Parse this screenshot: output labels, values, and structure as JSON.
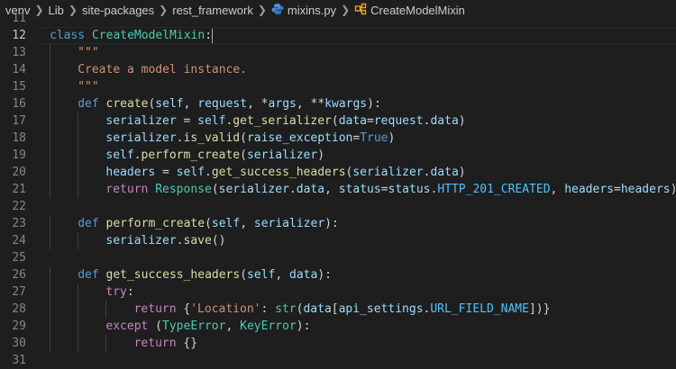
{
  "breadcrumb": {
    "items": [
      "venv",
      "Lib",
      "site-packages",
      "rest_framework",
      "mixins.py",
      "CreateModelMixin"
    ]
  },
  "editor": {
    "colors": {
      "background": "#1e1e1e",
      "keyword": "#569cd6",
      "class": "#4ec9b0",
      "function": "#dcdcaa",
      "string": "#ce9178"
    },
    "lines": [
      {
        "n": "11",
        "active": false,
        "indent": 0,
        "tokens": []
      },
      {
        "n": "12",
        "active": true,
        "indent": 0,
        "tokens": [
          [
            "kw",
            "class"
          ],
          [
            "plain",
            " "
          ],
          [
            "cls",
            "CreateModelMixin"
          ],
          [
            "plain",
            ":"
          ]
        ],
        "cursor": true
      },
      {
        "n": "13",
        "active": false,
        "indent": 1,
        "tokens": [
          [
            "str",
            "\"\"\""
          ]
        ]
      },
      {
        "n": "14",
        "active": false,
        "indent": 1,
        "tokens": [
          [
            "str",
            "Create a model instance."
          ]
        ]
      },
      {
        "n": "15",
        "active": false,
        "indent": 1,
        "tokens": [
          [
            "str",
            "\"\"\""
          ]
        ]
      },
      {
        "n": "16",
        "active": false,
        "indent": 1,
        "tokens": [
          [
            "kw",
            "def"
          ],
          [
            "plain",
            " "
          ],
          [
            "fn",
            "create"
          ],
          [
            "plain",
            "("
          ],
          [
            "self",
            "self"
          ],
          [
            "plain",
            ", "
          ],
          [
            "var",
            "request"
          ],
          [
            "plain",
            ", *"
          ],
          [
            "var",
            "args"
          ],
          [
            "plain",
            ", **"
          ],
          [
            "var",
            "kwargs"
          ],
          [
            "plain",
            "):"
          ]
        ]
      },
      {
        "n": "17",
        "active": false,
        "indent": 2,
        "tokens": [
          [
            "var",
            "serializer"
          ],
          [
            "plain",
            " = "
          ],
          [
            "self",
            "self"
          ],
          [
            "plain",
            "."
          ],
          [
            "fn",
            "get_serializer"
          ],
          [
            "plain",
            "("
          ],
          [
            "var",
            "data"
          ],
          [
            "plain",
            "="
          ],
          [
            "var",
            "request"
          ],
          [
            "plain",
            "."
          ],
          [
            "var",
            "data"
          ],
          [
            "plain",
            ")"
          ]
        ]
      },
      {
        "n": "18",
        "active": false,
        "indent": 2,
        "tokens": [
          [
            "var",
            "serializer"
          ],
          [
            "plain",
            "."
          ],
          [
            "fn",
            "is_valid"
          ],
          [
            "plain",
            "("
          ],
          [
            "var",
            "raise_exception"
          ],
          [
            "plain",
            "="
          ],
          [
            "kw",
            "True"
          ],
          [
            "plain",
            ")"
          ]
        ]
      },
      {
        "n": "19",
        "active": false,
        "indent": 2,
        "tokens": [
          [
            "self",
            "self"
          ],
          [
            "plain",
            "."
          ],
          [
            "fn",
            "perform_create"
          ],
          [
            "plain",
            "("
          ],
          [
            "var",
            "serializer"
          ],
          [
            "plain",
            ")"
          ]
        ]
      },
      {
        "n": "20",
        "active": false,
        "indent": 2,
        "tokens": [
          [
            "var",
            "headers"
          ],
          [
            "plain",
            " = "
          ],
          [
            "self",
            "self"
          ],
          [
            "plain",
            "."
          ],
          [
            "fn",
            "get_success_headers"
          ],
          [
            "plain",
            "("
          ],
          [
            "var",
            "serializer"
          ],
          [
            "plain",
            "."
          ],
          [
            "var",
            "data"
          ],
          [
            "plain",
            ")"
          ]
        ]
      },
      {
        "n": "21",
        "active": false,
        "indent": 2,
        "tokens": [
          [
            "flow",
            "return"
          ],
          [
            "plain",
            " "
          ],
          [
            "cls",
            "Response"
          ],
          [
            "plain",
            "("
          ],
          [
            "var",
            "serializer"
          ],
          [
            "plain",
            "."
          ],
          [
            "var",
            "data"
          ],
          [
            "plain",
            ", "
          ],
          [
            "var",
            "status"
          ],
          [
            "plain",
            "="
          ],
          [
            "var",
            "status"
          ],
          [
            "plain",
            "."
          ],
          [
            "const",
            "HTTP_201_CREATED"
          ],
          [
            "plain",
            ", "
          ],
          [
            "var",
            "headers"
          ],
          [
            "plain",
            "="
          ],
          [
            "var",
            "headers"
          ],
          [
            "plain",
            ")"
          ]
        ]
      },
      {
        "n": "22",
        "active": false,
        "indent": 0,
        "tokens": []
      },
      {
        "n": "23",
        "active": false,
        "indent": 1,
        "tokens": [
          [
            "kw",
            "def"
          ],
          [
            "plain",
            " "
          ],
          [
            "fn",
            "perform_create"
          ],
          [
            "plain",
            "("
          ],
          [
            "self",
            "self"
          ],
          [
            "plain",
            ", "
          ],
          [
            "var",
            "serializer"
          ],
          [
            "plain",
            "):"
          ]
        ]
      },
      {
        "n": "24",
        "active": false,
        "indent": 2,
        "tokens": [
          [
            "var",
            "serializer"
          ],
          [
            "plain",
            "."
          ],
          [
            "fn",
            "save"
          ],
          [
            "plain",
            "()"
          ]
        ]
      },
      {
        "n": "25",
        "active": false,
        "indent": 0,
        "tokens": []
      },
      {
        "n": "26",
        "active": false,
        "indent": 1,
        "tokens": [
          [
            "kw",
            "def"
          ],
          [
            "plain",
            " "
          ],
          [
            "fn",
            "get_success_headers"
          ],
          [
            "plain",
            "("
          ],
          [
            "self",
            "self"
          ],
          [
            "plain",
            ", "
          ],
          [
            "var",
            "data"
          ],
          [
            "plain",
            "):"
          ]
        ]
      },
      {
        "n": "27",
        "active": false,
        "indent": 2,
        "tokens": [
          [
            "flow",
            "try"
          ],
          [
            "plain",
            ":"
          ]
        ]
      },
      {
        "n": "28",
        "active": false,
        "indent": 3,
        "tokens": [
          [
            "flow",
            "return"
          ],
          [
            "plain",
            " {"
          ],
          [
            "str",
            "'Location'"
          ],
          [
            "plain",
            ": "
          ],
          [
            "cls",
            "str"
          ],
          [
            "plain",
            "("
          ],
          [
            "var",
            "data"
          ],
          [
            "plain",
            "["
          ],
          [
            "var",
            "api_settings"
          ],
          [
            "plain",
            "."
          ],
          [
            "const",
            "URL_FIELD_NAME"
          ],
          [
            "plain",
            "])}"
          ]
        ]
      },
      {
        "n": "29",
        "active": false,
        "indent": 2,
        "tokens": [
          [
            "flow",
            "except"
          ],
          [
            "plain",
            " ("
          ],
          [
            "cls",
            "TypeError"
          ],
          [
            "plain",
            ", "
          ],
          [
            "cls",
            "KeyError"
          ],
          [
            "plain",
            "):"
          ]
        ]
      },
      {
        "n": "30",
        "active": false,
        "indent": 3,
        "tokens": [
          [
            "flow",
            "return"
          ],
          [
            "plain",
            " {}"
          ]
        ]
      },
      {
        "n": "31",
        "active": false,
        "indent": 0,
        "tokens": []
      }
    ]
  }
}
